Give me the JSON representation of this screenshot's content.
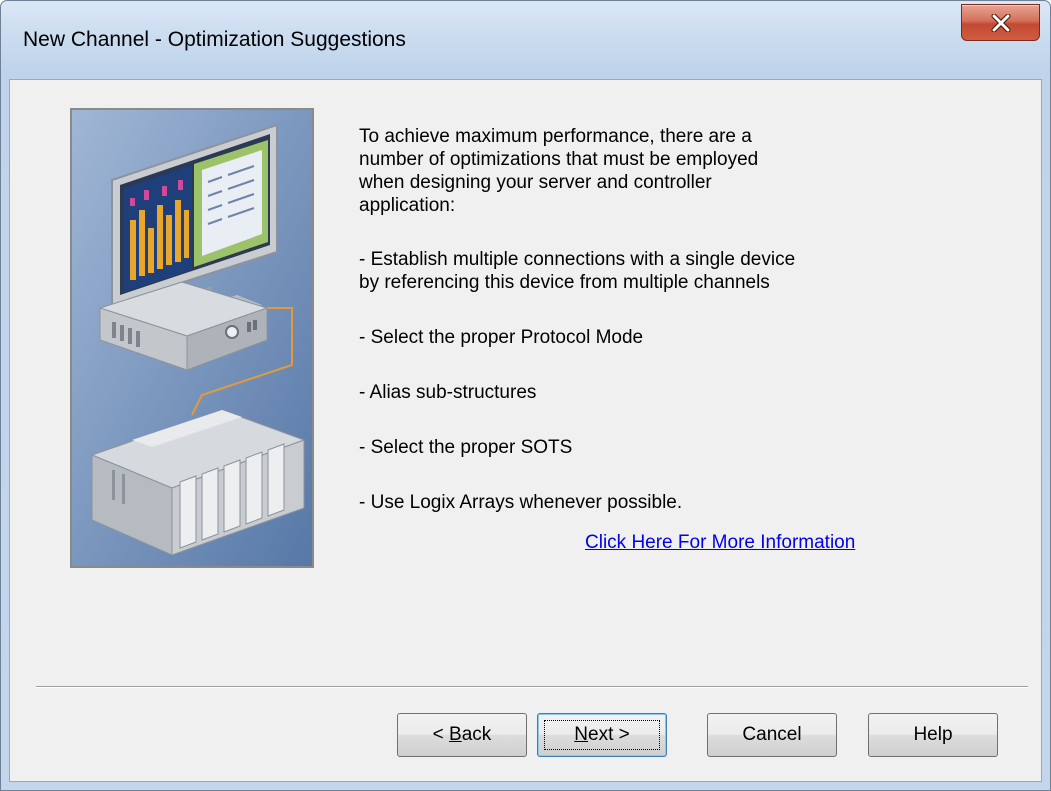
{
  "window": {
    "title": "New Channel - Optimization Suggestions",
    "close_icon": "close-x-icon"
  },
  "illustration": {
    "icon": "computer-and-controller-illustration"
  },
  "description": {
    "intro": "To achieve maximum performance, there are a\nnumber of optimizations that must be employed\nwhen designing your server and controller\napplication:",
    "items": [
      "- Establish multiple connections with a single device\nby referencing this device from multiple channels",
      "- Select the proper Protocol Mode",
      "- Alias sub-structures",
      "- Select the proper SOTS",
      "- Use Logix Arrays whenever possible."
    ]
  },
  "more_info_link": "Click Here For More Information",
  "buttons": {
    "back": {
      "prefix": "< ",
      "mnemonic": "B",
      "rest": "ack"
    },
    "next": {
      "mnemonic": "N",
      "rest": "ext >"
    },
    "cancel": "Cancel",
    "help": "Help"
  },
  "colors": {
    "link": "#0000ee",
    "illustration_background": "#6d8fbf",
    "close_button": "#c24a33"
  }
}
